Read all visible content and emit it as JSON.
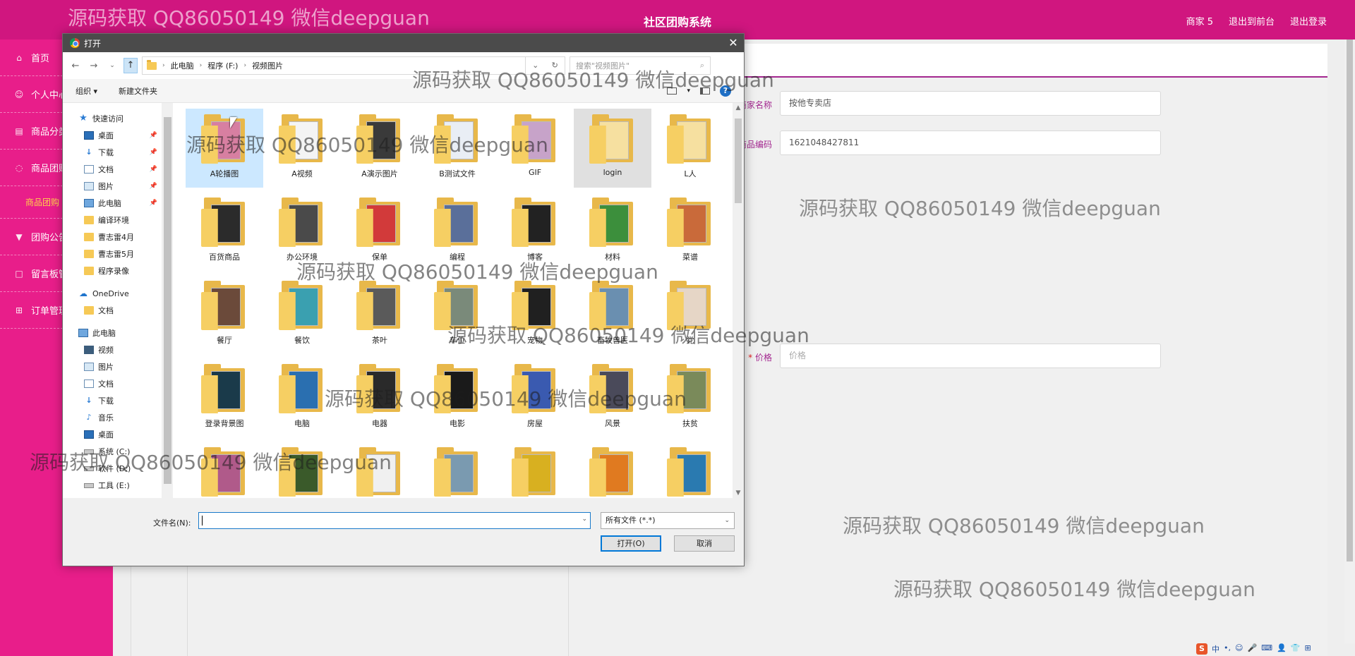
{
  "app": {
    "title": "社区团购系统",
    "top_links": [
      "商家 5",
      "退出到前台",
      "退出登录"
    ]
  },
  "sidebar": {
    "items": [
      {
        "label": "首页",
        "icon": "home-icon"
      },
      {
        "label": "个人中心",
        "icon": "user-icon"
      },
      {
        "label": "商品分类",
        "icon": "category-icon"
      },
      {
        "label": "商品团购",
        "icon": "bulb-icon"
      },
      {
        "label": "团购公告",
        "icon": "notice-icon"
      },
      {
        "label": "留言板管理",
        "icon": "message-icon"
      },
      {
        "label": "订单管理",
        "icon": "grid-icon"
      }
    ],
    "active_sub": "商品团购"
  },
  "form": {
    "shop_name_label": "商家名称",
    "shop_name_value": "按他专卖店",
    "code_label": "商品编码",
    "code_value": "1621048427811",
    "price_required": "*",
    "price_label": "价格",
    "price_placeholder": "价格"
  },
  "dialog": {
    "title": "打开",
    "breadcrumb": [
      "此电脑",
      "程序 (F:)",
      "视频图片"
    ],
    "search_placeholder": "搜索\"视频图片\"",
    "organize": "组织 ▾",
    "new_folder": "新建文件夹",
    "help": "?",
    "tree": [
      {
        "label": "快速访问",
        "icon": "star-icon",
        "pinned": false
      },
      {
        "label": "桌面",
        "icon": "desktop-icon",
        "pinned": true
      },
      {
        "label": "下载",
        "icon": "download-icon",
        "pinned": true
      },
      {
        "label": "文档",
        "icon": "document-icon",
        "pinned": true
      },
      {
        "label": "图片",
        "icon": "picture-icon",
        "pinned": true
      },
      {
        "label": "此电脑",
        "icon": "computer-icon",
        "pinned": true
      },
      {
        "label": "编译环境",
        "icon": "folder-icon",
        "pinned": false
      },
      {
        "label": "曹志雷4月",
        "icon": "folder-icon",
        "pinned": false
      },
      {
        "label": "曹志雷5月",
        "icon": "folder-icon",
        "pinned": false
      },
      {
        "label": "程序录像",
        "icon": "folder-icon",
        "pinned": false
      },
      {
        "label": "OneDrive",
        "icon": "cloud-icon",
        "pinned": false
      },
      {
        "label": "文档",
        "icon": "folder-icon",
        "pinned": false
      },
      {
        "label": "此电脑",
        "icon": "computer-icon",
        "pinned": false
      },
      {
        "label": "视频",
        "icon": "video-icon",
        "pinned": false
      },
      {
        "label": "图片",
        "icon": "picture-icon",
        "pinned": false
      },
      {
        "label": "文档",
        "icon": "document-icon",
        "pinned": false
      },
      {
        "label": "下载",
        "icon": "download-icon",
        "pinned": false
      },
      {
        "label": "音乐",
        "icon": "music-icon",
        "pinned": false
      },
      {
        "label": "桌面",
        "icon": "desktop-icon",
        "pinned": false
      },
      {
        "label": "系统 (C:)",
        "icon": "drive-icon",
        "pinned": false
      },
      {
        "label": "软件 (D:)",
        "icon": "drive-icon",
        "pinned": false
      },
      {
        "label": "工具 (E:)",
        "icon": "drive-icon",
        "pinned": false
      }
    ],
    "files": [
      {
        "name": "A轮播图",
        "color": "#d77fa1"
      },
      {
        "name": "A视频",
        "color": "#f4f4f4"
      },
      {
        "name": "A演示图片",
        "color": "#3a3a3a"
      },
      {
        "name": "B测试文件",
        "color": "#e9eef5"
      },
      {
        "name": "GIF",
        "color": "#c7a3c9"
      },
      {
        "name": "login",
        "color": "#f6e0a0"
      },
      {
        "name": "L人",
        "color": "#f6e0a0"
      },
      {
        "name": "百货商品",
        "color": "#2b2b2b"
      },
      {
        "name": "办公环境",
        "color": "#4a4a4a"
      },
      {
        "name": "保单",
        "color": "#d23a3a"
      },
      {
        "name": "编程",
        "color": "#5a6f9a"
      },
      {
        "name": "博客",
        "color": "#222222"
      },
      {
        "name": "材料",
        "color": "#3c8f3c"
      },
      {
        "name": "菜谱",
        "color": "#c96a3a"
      },
      {
        "name": "餐厅",
        "color": "#6b4a3a"
      },
      {
        "name": "餐饮",
        "color": "#3aa0b0"
      },
      {
        "name": "茶叶",
        "color": "#5a5a5a"
      },
      {
        "name": "车位",
        "color": "#7a8a7a"
      },
      {
        "name": "宠物",
        "color": "#202020"
      },
      {
        "name": "畜牧兽医",
        "color": "#6a8fb0"
      },
      {
        "name": "党",
        "color": "#e6d6c6"
      },
      {
        "name": "登录背景图",
        "color": "#1a3a4a"
      },
      {
        "name": "电脑",
        "color": "#2a6fb0"
      },
      {
        "name": "电器",
        "color": "#2a2a2a"
      },
      {
        "name": "电影",
        "color": "#1a1a1a"
      },
      {
        "name": "房屋",
        "color": "#3a5ab0"
      },
      {
        "name": "风景",
        "color": "#4a4a5a"
      },
      {
        "name": "扶贫",
        "color": "#7a8a5a"
      },
      {
        "name": "",
        "color": "#b05a8a"
      },
      {
        "name": "",
        "color": "#3a5a2a"
      },
      {
        "name": "",
        "color": "#f0f0f0"
      },
      {
        "name": "",
        "color": "#7a9ab0"
      },
      {
        "name": "",
        "color": "#d8b020"
      },
      {
        "name": "",
        "color": "#e07a20"
      },
      {
        "name": "",
        "color": "#2a7ab0"
      }
    ],
    "filename_label": "文件名(N):",
    "filename_value": "",
    "filetype": "所有文件 (*.*)",
    "open_button": "打开(O)",
    "cancel_button": "取消"
  },
  "watermark": "源码获取 QQ86050149 微信deepguan",
  "colors": {
    "brand": "#d0167f",
    "sidebar": "#e81e8a",
    "accent_text": "#a3278f"
  }
}
